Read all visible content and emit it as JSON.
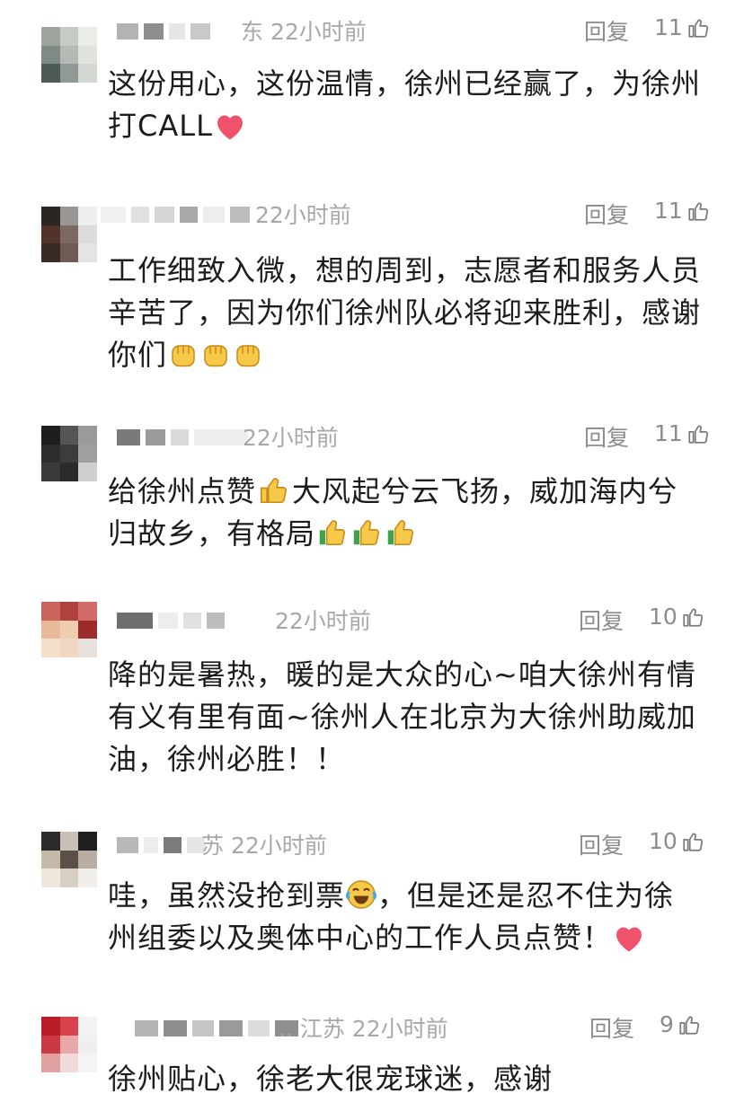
{
  "comments": [
    {
      "location_time": "东 22小时前",
      "reply": "回复",
      "likes": "11",
      "text": "这份用心，这份温情，徐州已经赢了，为徐州打CALL",
      "emoji": [
        "heart"
      ]
    },
    {
      "location_time": "22小时前",
      "reply": "回复",
      "likes": "11",
      "text": "工作细致入微，想的周到，志愿者和服务人员辛苦了，因为你们徐州队必将迎来胜利，感谢你们",
      "emoji": [
        "fist",
        "fist",
        "fist"
      ]
    },
    {
      "location_time": "22小时前",
      "reply": "回复",
      "likes": "11",
      "text_a": "给徐州点赞",
      "text_b": "大风起兮云飞扬，威加海内兮归故乡，有格局",
      "emoji": [
        "thumbs-up",
        "thumbs-up",
        "thumbs-up",
        "thumbs-up"
      ]
    },
    {
      "location_time": "22小时前",
      "reply": "回复",
      "likes": "10",
      "text": "降的是暑热，暖的是大众的心~咱大徐州有情有义有里有面~徐州人在北京为大徐州助威加油，徐州必胜！！"
    },
    {
      "location_time": "苏 22小时前",
      "reply": "回复",
      "likes": "10",
      "text_a": "哇，虽然没抢到票",
      "text_b": "，但是还是忍不住为徐州组委以及奥体中心的工作人员点赞！",
      "emoji": [
        "laugh-cry",
        "heart"
      ]
    },
    {
      "location_time": "江苏 22小时前",
      "reply": "回复",
      "likes": "9",
      "text": "徐州贴心，徐老大很宠球迷，感谢"
    }
  ],
  "colors": {
    "meta": "#a8a8a8",
    "text": "#1c1c1c",
    "heart": "#f0526c",
    "emoji_yellow": "#f7c948"
  }
}
